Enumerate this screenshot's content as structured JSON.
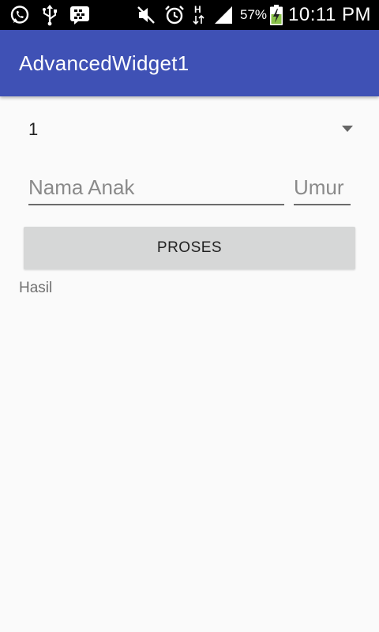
{
  "status_bar": {
    "left_icons": [
      "whatsapp-icon",
      "usb-icon",
      "bbm-icon"
    ],
    "right_icons": [
      "mute-icon",
      "alarm-icon",
      "h-data-icon",
      "signal-icon",
      "battery-charging-icon"
    ],
    "battery_percent": "57%",
    "time": "10:11 PM"
  },
  "app_bar": {
    "title": "AdvancedWidget1",
    "color": "#3f51b5"
  },
  "spinner": {
    "selected_value": "1"
  },
  "form": {
    "name_placeholder": "Nama Anak",
    "age_placeholder": "Umur",
    "name_value": "",
    "age_value": ""
  },
  "actions": {
    "process_label": "PROSES"
  },
  "result": {
    "label": "Hasil"
  }
}
